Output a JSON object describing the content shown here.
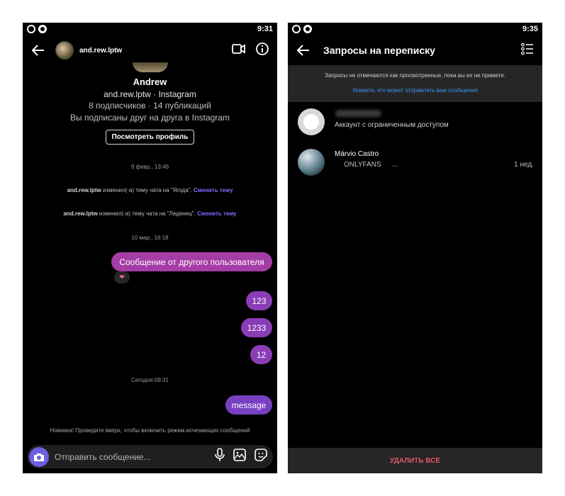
{
  "left": {
    "status": {
      "time": "9:31"
    },
    "header": {
      "username": "and.rew.lptw",
      "icons": [
        "back-arrow-icon",
        "video-call-icon",
        "info-icon"
      ]
    },
    "profile": {
      "name": "Andrew",
      "handle": "and.rew.lptw · Instagram",
      "stats": "8 подписчиков · 14 публикаций",
      "mutual": "Вы подписаны друг на друга в Instagram",
      "view_button": "Посмотреть профиль"
    },
    "thread": {
      "ts1": "9 февр., 13:46",
      "sys1_user": "and.rew.lptw",
      "sys1_text": "изменил(-а) тему чата на \"Ягода\".",
      "sys1_link": "Сменить тему",
      "sys2_user": "and.rew.lptw",
      "sys2_text": "изменил(-а) тему чата на \"Леденец\".",
      "sys2_link": "Сменить тему",
      "ts2": "10 мар., 16:18",
      "msg1": "Сообщение от другого пользователя",
      "reaction": "❤",
      "msg2": "123",
      "msg3": "1233",
      "msg4": "12",
      "ts3": "Сегодня 09:31",
      "msg5": "message"
    },
    "hint": "Новинка! Проведите вверх, чтобы включить режим исчезающих сообщений",
    "composer": {
      "placeholder": "Отправить сообщение...",
      "icons": [
        "camera-icon",
        "microphone-icon",
        "gallery-icon",
        "sticker-icon"
      ]
    }
  },
  "right": {
    "status": {
      "time": "9:35"
    },
    "header": {
      "title": "Запросы на переписку",
      "icons": [
        "back-arrow-icon",
        "select-list-icon"
      ]
    },
    "banner": {
      "text": "Запросы не отмечаются как просмотренные, пока вы их не примете.",
      "link": "Укажите, кто может отправлять вам сообщения"
    },
    "requests": [
      {
        "subtitle": "Аккаунт с ограниченным доступом"
      },
      {
        "name": "Márvio Castro",
        "preview": "ONLYFANS",
        "ellipsis": "...",
        "time": "1 нед."
      }
    ],
    "delete_all": "УДАЛИТЬ ВСЕ"
  },
  "colors": {
    "bubble_pink": "#a53da7",
    "bubble_purple": "#8b3db7",
    "bubble_violet": "#7840c2",
    "link_blue": "#3a97f0",
    "delete_red": "#e0566b",
    "camera_button": "#6c5fe0"
  }
}
